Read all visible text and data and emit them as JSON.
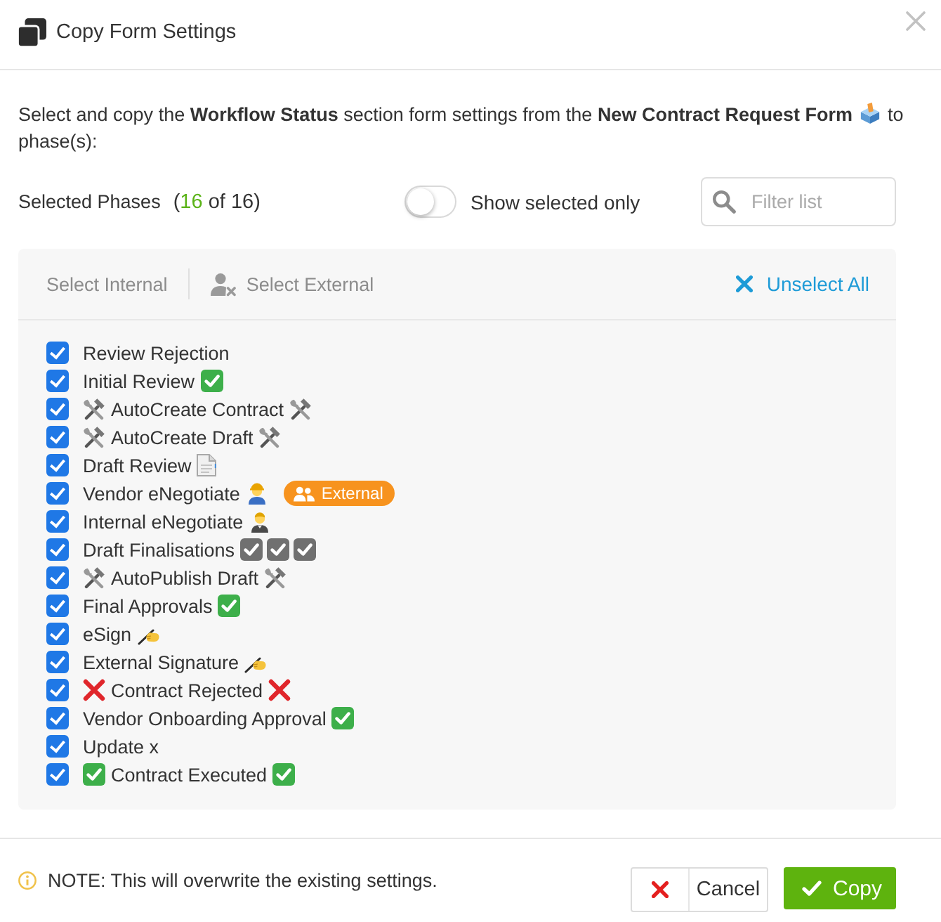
{
  "dialog": {
    "title": "Copy Form Settings"
  },
  "intro": {
    "text": "Select and copy the **Workflow Status** section form settings from the **New Contract Request Form**",
    "after": "to phase(s):"
  },
  "selection": {
    "label": "Selected Phases",
    "count": {
      "open": "(",
      "value": "16",
      "rest": " of 16)"
    },
    "toggle": {
      "label": "Show selected only",
      "on": false
    },
    "filter": {
      "placeholder": "Filter list"
    }
  },
  "toolbar": [
    {
      "label": "Select Internal",
      "kind": "plain"
    },
    {
      "label": "Select External",
      "kind": "user_gear"
    },
    {
      "label": "Unselect All",
      "kind": "unselect"
    }
  ],
  "phases": [
    {
      "label": "Review Rejection",
      "checked": true
    },
    {
      "label": "Initial Review",
      "checked": true,
      "trail": [
        {
          "kind": "check"
        }
      ]
    },
    {
      "label": "AutoCreate Contract",
      "checked": true,
      "lead": {
        "kind": "tools"
      },
      "trail": [
        {
          "kind": "tools"
        }
      ]
    },
    {
      "label": "AutoCreate Draft",
      "checked": true,
      "lead": {
        "kind": "tools"
      },
      "trail": [
        {
          "kind": "tools"
        }
      ]
    },
    {
      "label": "Draft Review",
      "checked": true,
      "trail": [
        {
          "kind": "page"
        }
      ]
    },
    {
      "label": "Vendor eNegotiate",
      "checked": true,
      "trail": [
        {
          "kind": "worker"
        }
      ],
      "badge": {
        "label": "External"
      }
    },
    {
      "label": "Internal eNegotiate",
      "checked": true,
      "trail": [
        {
          "kind": "office_worker"
        }
      ]
    },
    {
      "label": "Draft Finalisations",
      "checked": true,
      "trail": [
        {
          "kind": "ballot_check"
        },
        {
          "kind": "ballot_check"
        },
        {
          "kind": "ballot_check"
        }
      ]
    },
    {
      "label": "AutoPublish Draft",
      "checked": true,
      "lead": {
        "kind": "tools"
      },
      "trail": [
        {
          "kind": "tools"
        }
      ]
    },
    {
      "label": "Final Approvals",
      "checked": true,
      "trail": [
        {
          "kind": "check"
        }
      ]
    },
    {
      "label": "eSign",
      "checked": true,
      "trail": [
        {
          "kind": "writing_hand"
        }
      ]
    },
    {
      "label": "External Signature",
      "checked": true,
      "trail": [
        {
          "kind": "writing_hand"
        }
      ]
    },
    {
      "label": "Contract Rejected",
      "checked": true,
      "lead": {
        "kind": "cross"
      },
      "trail": [
        {
          "kind": "cross"
        }
      ]
    },
    {
      "label": "Vendor Onboarding Approval",
      "checked": true,
      "trail": [
        {
          "kind": "check"
        }
      ]
    },
    {
      "label": "Update x",
      "checked": true
    },
    {
      "label": "Contract Executed",
      "checked": true,
      "lead": {
        "kind": "check"
      },
      "trail": [
        {
          "kind": "check"
        }
      ]
    }
  ],
  "footer": {
    "note": "NOTE: This will overwrite the existing settings.",
    "buttons": [
      {
        "label": "Cancel",
        "kind": "cancel"
      },
      {
        "label": "Copy",
        "kind": "primary"
      }
    ]
  }
}
